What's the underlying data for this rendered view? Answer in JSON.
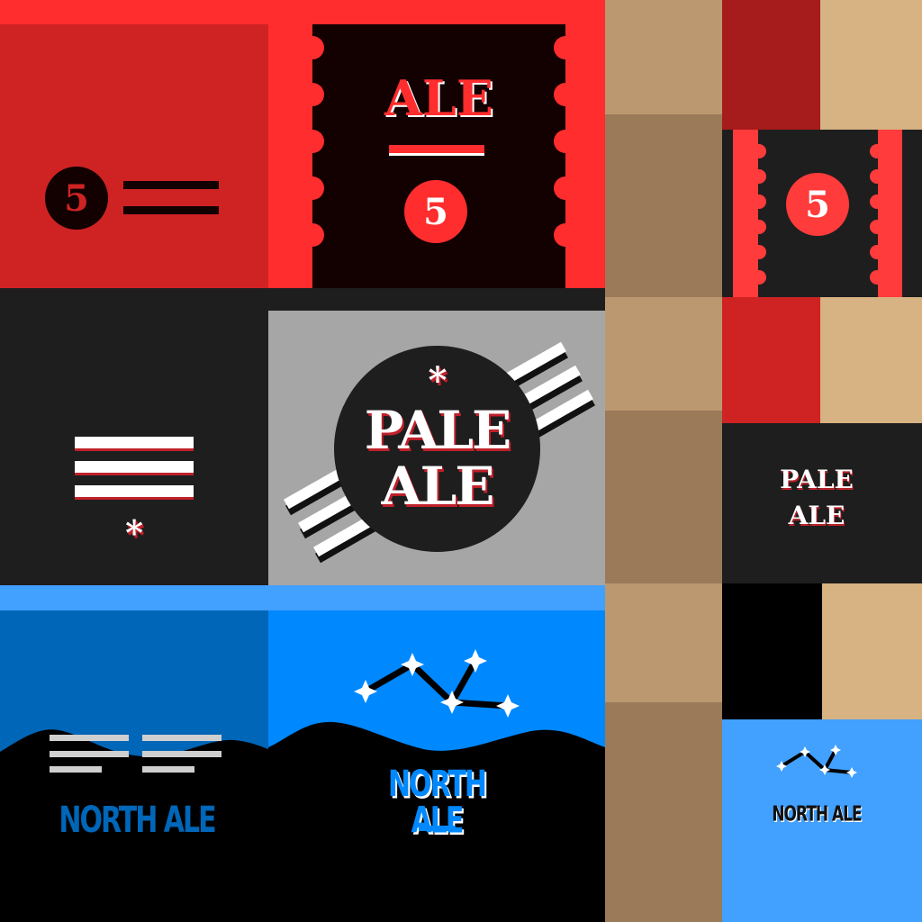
{
  "labels": {
    "red_badge": {
      "number": "5"
    },
    "red_ticket": {
      "title": "ALE",
      "number": "5"
    },
    "small_ticket": {
      "number": "5"
    },
    "pale_badge": {
      "line1": "PALE",
      "line2": "ALE",
      "star": "*"
    },
    "pale_left": {
      "star": "*"
    },
    "pale_small": {
      "line1": "PALE",
      "line2": "ALE"
    },
    "north_left": {
      "title": "NORTH ALE"
    },
    "north_center": {
      "title": "NORTH ALE"
    },
    "north_small": {
      "title": "NORTH ALE"
    }
  },
  "colors": {
    "red_bg": "#ff2d2d",
    "red_dark": "#cf2323",
    "ticket_black": "#130000",
    "charcoal": "#1e1e1e",
    "gray": "#a6a6a6",
    "blue_light": "#42a0ff",
    "blue": "#0088ff",
    "blue_dark": "#0066b8",
    "tan": "#bc9870",
    "tan_dark": "#9a7a58",
    "sand": "#d7b283",
    "brick": "#a61b1b"
  },
  "icons": [
    "star-icon",
    "constellation-icon",
    "mountain-silhouette",
    "ticket-notch"
  ]
}
